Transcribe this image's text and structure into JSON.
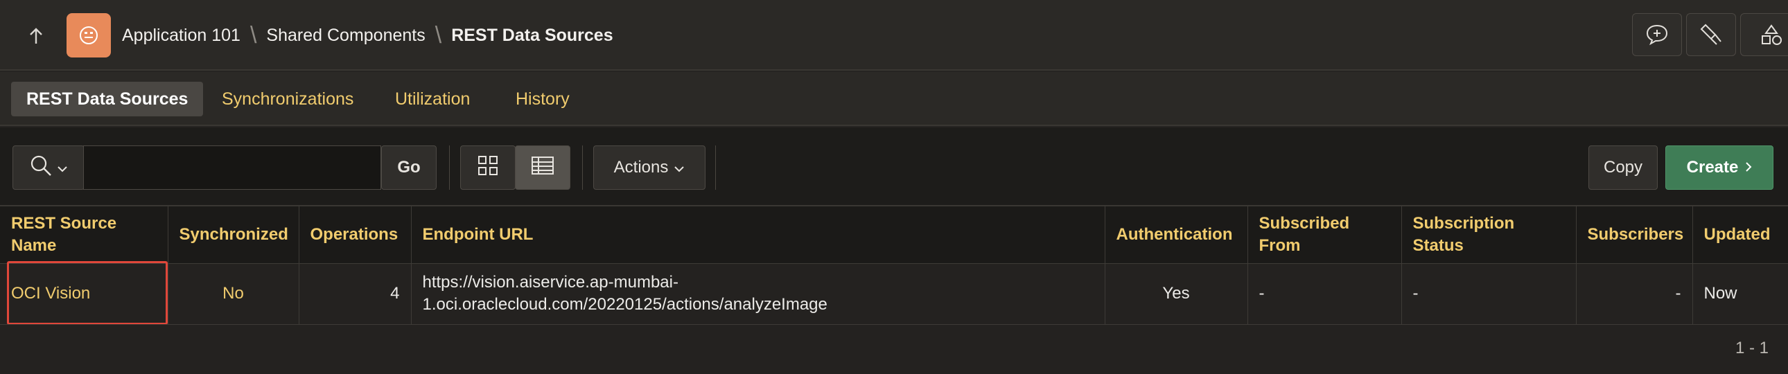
{
  "header": {
    "breadcrumbs": [
      "Application 101",
      "Shared Components",
      "REST Data Sources"
    ],
    "separator": "\\",
    "icons": [
      "up-arrow-icon",
      "app-face-icon",
      "chat-plus-icon",
      "flashlight-icon",
      "shapes-icon"
    ],
    "app_icon_color": "#e88a5a"
  },
  "tabs": [
    {
      "label": "REST Data Sources",
      "active": true
    },
    {
      "label": "Synchronizations",
      "active": false
    },
    {
      "label": "Utilization",
      "active": false
    },
    {
      "label": "History",
      "active": false
    }
  ],
  "toolbar": {
    "search_value": "",
    "go_label": "Go",
    "actions_label": "Actions",
    "copy_label": "Copy",
    "create_label": "Create",
    "create_color": "#3f7d56",
    "view_mode": "report"
  },
  "table": {
    "headers": [
      "REST Source Name",
      "Synchronized",
      "Operations",
      "Endpoint URL",
      "Authentication",
      "Subscribed From",
      "Subscription Status",
      "Subscribers",
      "Updated"
    ],
    "rows": [
      {
        "name": "OCI Vision",
        "synchronized": "No",
        "operations": "4",
        "endpoint_line1": "https://vision.aiservice.ap-mumbai-",
        "endpoint_line2": "1.oci.oraclecloud.com/20220125/actions/analyzeImage",
        "authentication": "Yes",
        "subscribed_from": "-",
        "subscription_status": "-",
        "subscribers": "-",
        "updated": "Now"
      }
    ],
    "highlight_color": "#e0473a"
  },
  "pagination": "1 - 1"
}
